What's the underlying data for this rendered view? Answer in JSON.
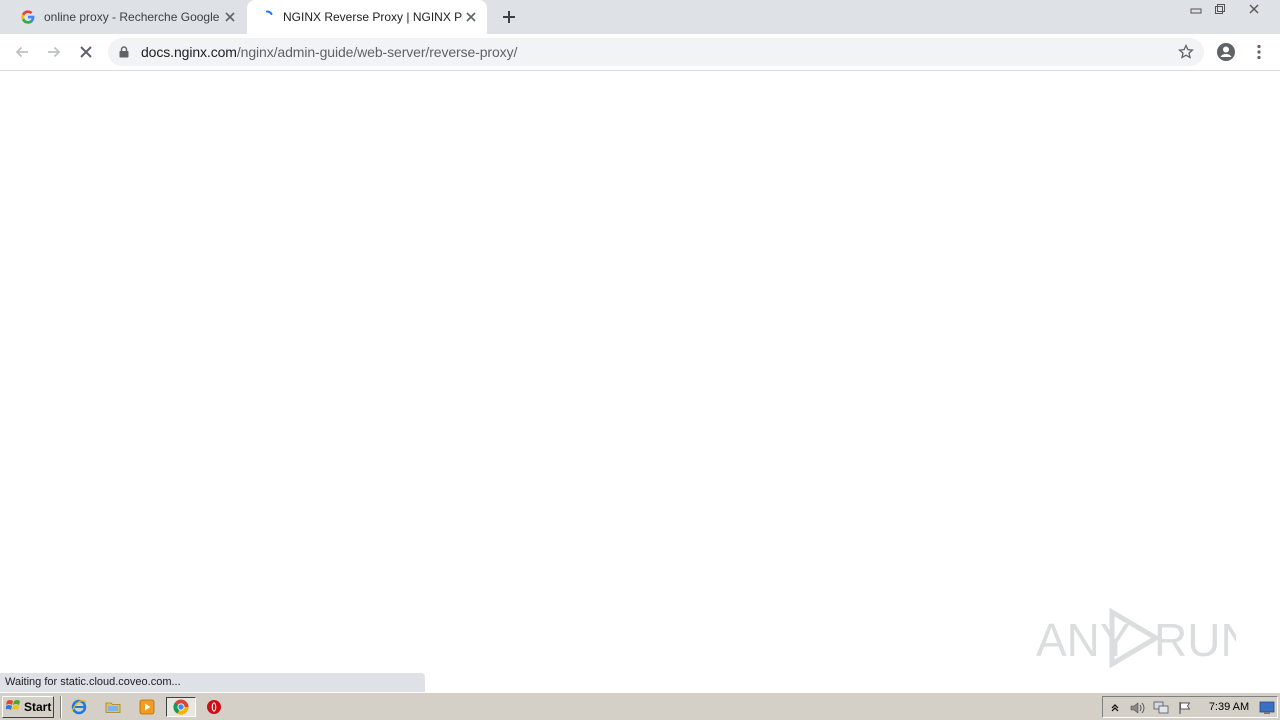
{
  "tabs": [
    {
      "title": "online proxy - Recherche Google",
      "favicon": "google-g-icon"
    },
    {
      "title": "NGINX Reverse Proxy | NGINX Plus",
      "favicon": "loading-spinner-icon",
      "active": true
    }
  ],
  "address_bar": {
    "domain": "docs.nginx.com",
    "path": "/nginx/admin-guide/web-server/reverse-proxy/"
  },
  "status_bar": {
    "text": "Waiting for static.cloud.coveo.com..."
  },
  "watermark": {
    "text_left": "ANY",
    "text_right": "RUN"
  },
  "taskbar": {
    "start_label": "Start",
    "clock": "7:39 AM"
  },
  "colors": {
    "tabstrip_bg": "#dee1e6",
    "omnibox_bg": "#f1f3f4",
    "taskbar_bg": "#d4d0c8",
    "spinner_blue": "#1a73e8"
  }
}
